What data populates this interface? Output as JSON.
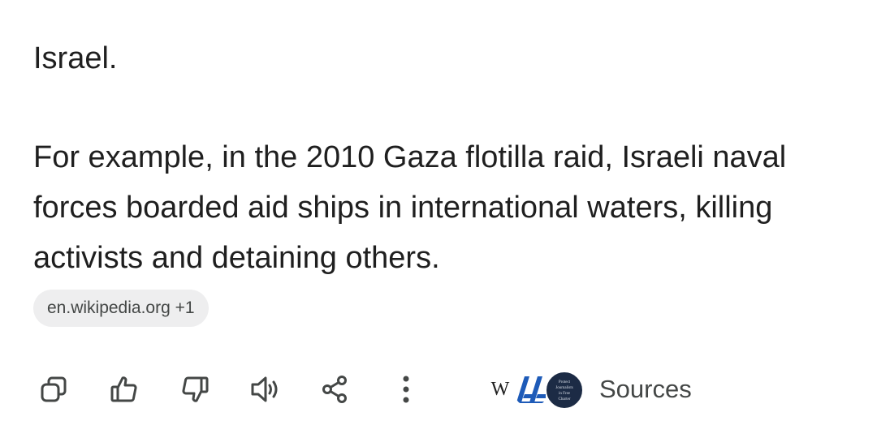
{
  "response": {
    "paragraphs": [
      "Israel.",
      "For example, in the 2010 Gaza flotilla raid, Israeli naval forces boarded aid ships in international waters, killing activists and detaining others."
    ],
    "source_chip": "en.wikipedia.org +1"
  },
  "actions": {
    "copy_icon": "copy-icon",
    "thumbs_up_icon": "thumbs-up-icon",
    "thumbs_down_icon": "thumbs-down-icon",
    "read_aloud_icon": "speaker-icon",
    "share_icon": "share-icon",
    "more_icon": "more-vertical-icon"
  },
  "sources": {
    "label": "Sources",
    "favicons": [
      "wikipedia-favicon",
      "anadolu-agency-favicon",
      "press-freedom-org-favicon"
    ],
    "wikipedia_letter": "W",
    "anadolu_letters": "AA",
    "org_lines": [
      "Protect",
      "Journalists",
      "in Free",
      "Charter"
    ]
  },
  "colors": {
    "text": "#1f1f1f",
    "icon": "#444746",
    "chip_bg": "#eeeeef",
    "anadolu_blue": "#1e5bb8",
    "org_navy": "#1c2b45"
  }
}
